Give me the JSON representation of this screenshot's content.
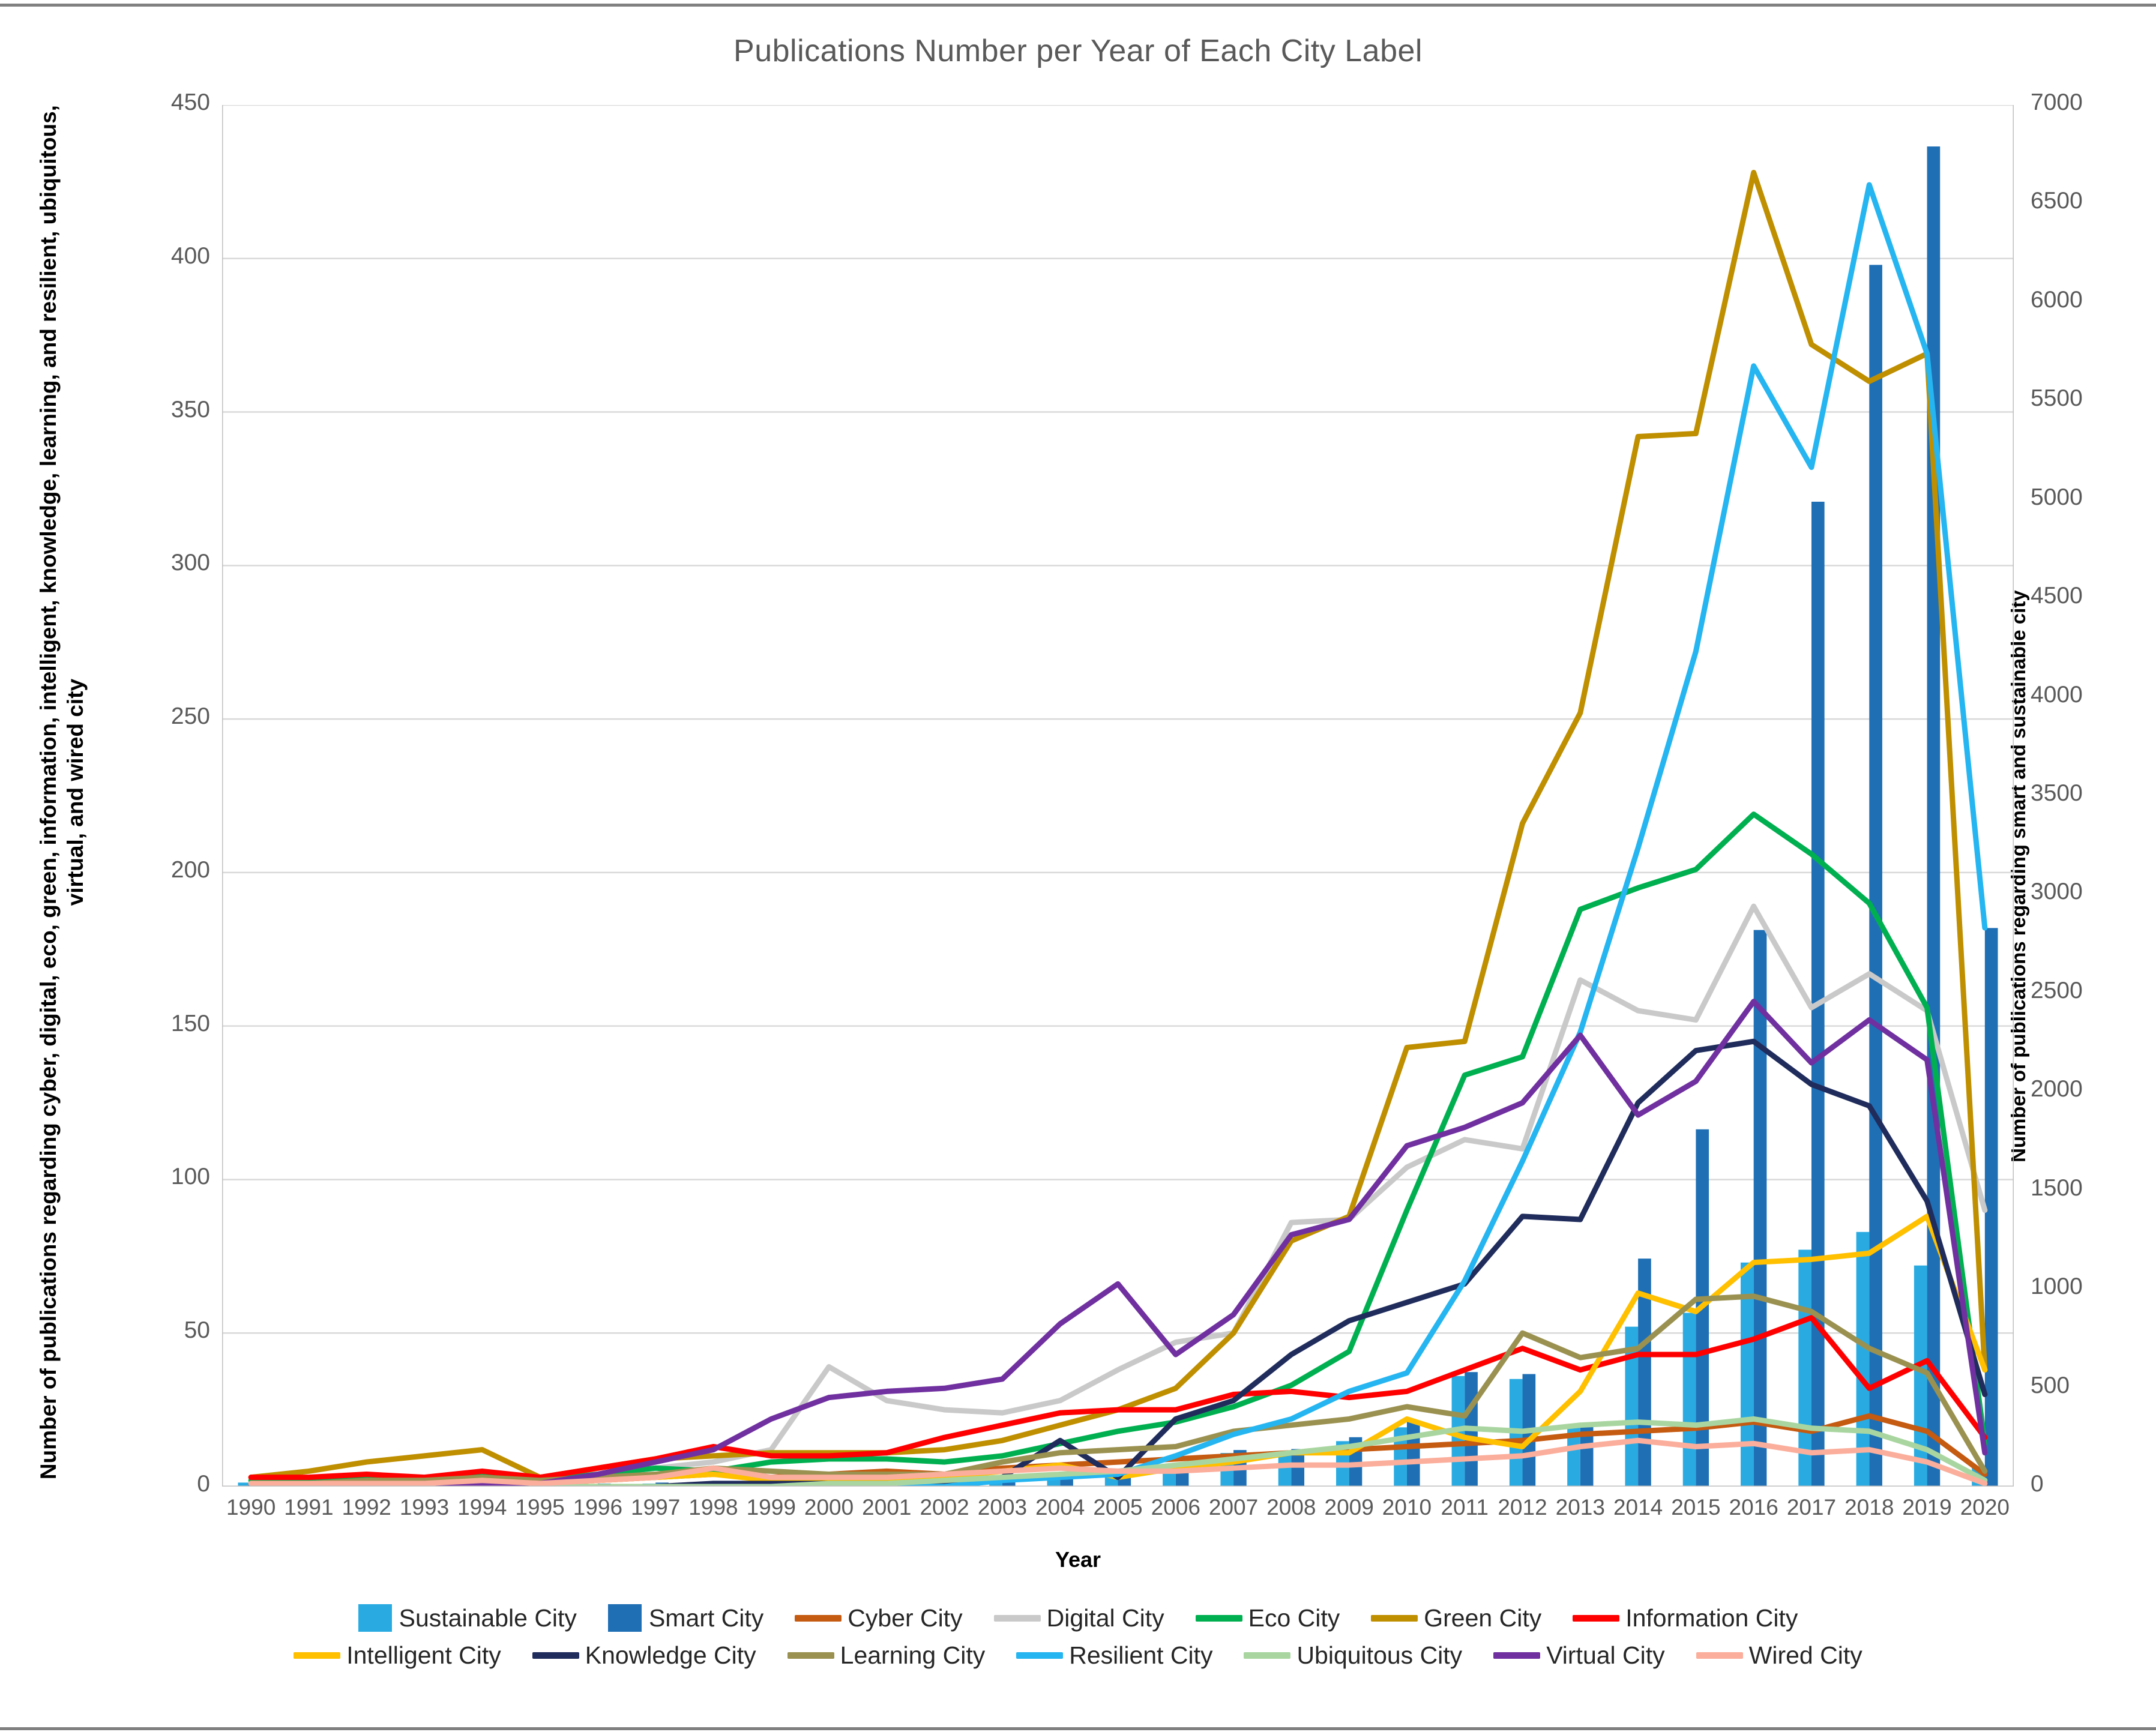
{
  "chart_data": {
    "type": "line",
    "title": "Publications Number per Year of Each City Label",
    "xlabel": "Year",
    "ylabel": "Number of publications  regarding cyber, digital, eco, green, information, intelligent, knowledge, learning, and resilient, ubiquitous, virtual, and wired city",
    "ylabel_secondary": "Number of publications  regarding smart and sustainable city",
    "ylim": [
      0,
      450
    ],
    "ylim_secondary": [
      0,
      7000
    ],
    "yticks": [
      0,
      50,
      100,
      150,
      200,
      250,
      300,
      350,
      400,
      450
    ],
    "yticks_secondary": [
      0,
      500,
      1000,
      1500,
      2000,
      2500,
      3000,
      3500,
      4000,
      4500,
      5000,
      5500,
      6000,
      6500,
      7000
    ],
    "grid": true,
    "legend_position": "bottom",
    "categories": [
      1990,
      1991,
      1992,
      1993,
      1994,
      1995,
      1996,
      1997,
      1998,
      1999,
      2000,
      2001,
      2002,
      2003,
      2004,
      2005,
      2006,
      2007,
      2008,
      2009,
      2010,
      2011,
      2012,
      2013,
      2014,
      2015,
      2016,
      2017,
      2018,
      2019,
      2020
    ],
    "bar_series": [
      {
        "name": "Sustainable City",
        "color": "#29ABE2",
        "axis": "secondary",
        "values": [
          20,
          5,
          5,
          5,
          10,
          5,
          10,
          15,
          15,
          20,
          25,
          30,
          35,
          40,
          50,
          65,
          110,
          170,
          175,
          230,
          300,
          560,
          545,
          305,
          810,
          880,
          1135,
          1200,
          1290,
          1120,
          100
        ]
      },
      {
        "name": "Smart City",
        "color": "#1F6FB5",
        "axis": "secondary",
        "values": [
          25,
          10,
          10,
          10,
          15,
          10,
          15,
          20,
          20,
          25,
          30,
          35,
          40,
          45,
          55,
          70,
          120,
          185,
          190,
          250,
          330,
          580,
          570,
          320,
          1155,
          1810,
          2820,
          4990,
          6190,
          6790,
          2830
        ]
      }
    ],
    "series": [
      {
        "name": "Cyber City",
        "color": "#C55A11",
        "values": [
          1,
          1,
          2,
          1,
          2,
          1,
          2,
          3,
          4,
          3,
          4,
          5,
          4,
          6,
          7,
          8,
          9,
          10,
          11,
          12,
          13,
          14,
          15,
          17,
          18,
          19,
          21,
          18,
          23,
          18,
          4
        ]
      },
      {
        "name": "Digital City",
        "color": "#C9C9C9",
        "values": [
          0,
          1,
          1,
          2,
          2,
          3,
          4,
          6,
          8,
          12,
          39,
          28,
          25,
          24,
          28,
          38,
          47,
          50,
          86,
          87,
          104,
          113,
          110,
          165,
          155,
          152,
          189,
          156,
          167,
          155,
          90
        ]
      },
      {
        "name": "Eco City",
        "color": "#00B050",
        "values": [
          2,
          2,
          3,
          2,
          4,
          2,
          4,
          6,
          5,
          8,
          9,
          9,
          8,
          10,
          14,
          18,
          21,
          26,
          33,
          44,
          90,
          134,
          140,
          188,
          195,
          201,
          219,
          206,
          190,
          156,
          14
        ]
      },
      {
        "name": "Green City",
        "color": "#BF8F00",
        "values": [
          3,
          5,
          8,
          10,
          12,
          3,
          6,
          9,
          10,
          11,
          11,
          11,
          12,
          15,
          20,
          25,
          32,
          50,
          80,
          88,
          143,
          145,
          216,
          252,
          342,
          343,
          428,
          372,
          360,
          369,
          38
        ]
      },
      {
        "name": "Information City",
        "color": "#FF0000",
        "values": [
          3,
          3,
          4,
          3,
          5,
          3,
          6,
          9,
          13,
          10,
          10,
          11,
          16,
          20,
          24,
          25,
          25,
          30,
          31,
          29,
          31,
          38,
          45,
          38,
          43,
          43,
          48,
          55,
          32,
          41,
          16
        ]
      },
      {
        "name": "Intelligent City",
        "color": "#FFC000",
        "values": [
          1,
          1,
          1,
          1,
          1,
          1,
          2,
          3,
          4,
          2,
          2,
          2,
          3,
          5,
          7,
          3,
          6,
          8,
          11,
          11,
          22,
          16,
          13,
          31,
          63,
          57,
          73,
          74,
          76,
          88,
          38
        ]
      },
      {
        "name": "Knowledge City",
        "color": "#1F2C5C",
        "values": [
          0,
          0,
          0,
          0,
          0,
          0,
          0,
          0,
          1,
          1,
          1,
          1,
          1,
          3,
          15,
          3,
          22,
          28,
          43,
          54,
          60,
          66,
          88,
          87,
          125,
          142,
          145,
          131,
          124,
          93,
          30
        ]
      },
      {
        "name": "Learning City",
        "color": "#9A9150",
        "values": [
          1,
          1,
          2,
          2,
          3,
          2,
          3,
          4,
          6,
          5,
          4,
          4,
          4,
          8,
          11,
          12,
          13,
          18,
          20,
          22,
          26,
          23,
          50,
          42,
          45,
          61,
          62,
          57,
          45,
          37,
          5
        ]
      },
      {
        "name": "Resilient City",
        "color": "#25B5F0",
        "values": [
          0,
          0,
          0,
          0,
          0,
          0,
          0,
          0,
          0,
          0,
          0,
          0,
          0,
          2,
          3,
          4,
          10,
          17,
          22,
          31,
          37,
          67,
          106,
          148,
          208,
          272,
          365,
          332,
          424,
          369,
          182
        ]
      },
      {
        "name": "Ubiquitous City",
        "color": "#A9D6A0",
        "values": [
          0,
          0,
          0,
          0,
          0,
          0,
          0,
          0,
          0,
          0,
          1,
          1,
          2,
          3,
          4,
          5,
          7,
          9,
          11,
          13,
          16,
          19,
          18,
          20,
          21,
          20,
          22,
          19,
          18,
          12,
          2
        ]
      },
      {
        "name": "Virtual City",
        "color": "#7030A0",
        "values": [
          0,
          0,
          0,
          1,
          1,
          1,
          4,
          8,
          12,
          22,
          29,
          31,
          32,
          35,
          53,
          66,
          43,
          56,
          82,
          87,
          111,
          117,
          125,
          147,
          121,
          132,
          158,
          138,
          152,
          139,
          11
        ]
      },
      {
        "name": "Wired City",
        "color": "#FBAE9B",
        "values": [
          1,
          1,
          1,
          1,
          2,
          1,
          2,
          3,
          6,
          3,
          3,
          3,
          4,
          5,
          6,
          5,
          5,
          6,
          7,
          7,
          8,
          9,
          10,
          13,
          15,
          13,
          14,
          11,
          12,
          8,
          1
        ]
      }
    ]
  },
  "legend": {
    "rows": [
      [
        {
          "label": "Sustainable City",
          "type": "bar",
          "color": "#29ABE2"
        },
        {
          "label": "Smart City",
          "type": "bar",
          "color": "#1F6FB5"
        },
        {
          "label": "Cyber City",
          "type": "line",
          "color": "#C55A11"
        },
        {
          "label": "Digital City",
          "type": "line",
          "color": "#C9C9C9"
        },
        {
          "label": "Eco City",
          "type": "line",
          "color": "#00B050"
        },
        {
          "label": "Green City",
          "type": "line",
          "color": "#BF8F00"
        },
        {
          "label": "Information City",
          "type": "line",
          "color": "#FF0000"
        }
      ],
      [
        {
          "label": "Intelligent City",
          "type": "line",
          "color": "#FFC000"
        },
        {
          "label": "Knowledge City",
          "type": "line",
          "color": "#1F2C5C"
        },
        {
          "label": "Learning City",
          "type": "line",
          "color": "#9A9150"
        },
        {
          "label": "Resilient City",
          "type": "line",
          "color": "#25B5F0"
        },
        {
          "label": "Ubiquitous City",
          "type": "line",
          "color": "#A9D6A0"
        },
        {
          "label": "Virtual City",
          "type": "line",
          "color": "#7030A0"
        },
        {
          "label": "Wired City",
          "type": "line",
          "color": "#FBAE9B"
        }
      ]
    ]
  },
  "colors": {
    "title": "#595959",
    "tick": "#595959",
    "grid": "#D9D9D9",
    "frame": "#808080",
    "axis_title": "#000000"
  }
}
